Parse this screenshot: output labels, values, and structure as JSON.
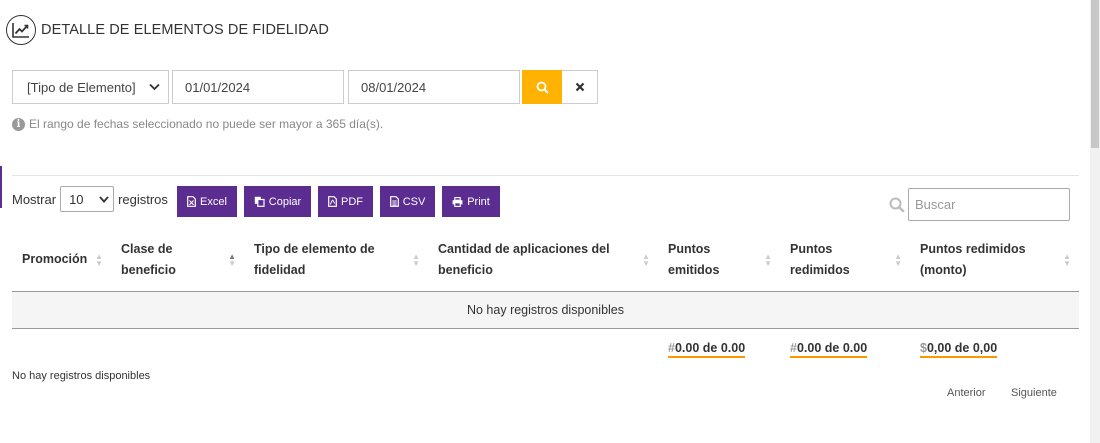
{
  "header": {
    "title": "DETALLE DE ELEMENTOS DE FIDELIDAD",
    "icon": "trend-chart-icon"
  },
  "filters": {
    "element_type": "[Tipo de Elemento]",
    "date_from": "01/01/2024",
    "date_to": "08/01/2024",
    "search_button_icon": "search-icon",
    "clear_button_icon": "close-icon"
  },
  "notice": "El rango de fechas seleccionado no puede ser mayor a 365 día(s).",
  "length": {
    "prefix": "Mostrar",
    "value": "10",
    "suffix": "registros"
  },
  "buttons": {
    "excel": "Excel",
    "copy": "Copiar",
    "pdf": "PDF",
    "csv": "CSV",
    "print": "Print"
  },
  "search": {
    "placeholder": "Buscar"
  },
  "table": {
    "columns": [
      "Promoción",
      "Clase de beneficio",
      "Tipo de elemento de fidelidad",
      "Cantidad de aplicaciones del beneficio",
      "Puntos emitidos",
      "Puntos redimidos",
      "Puntos redimidos (monto)"
    ],
    "empty": "No hay registros disponibles"
  },
  "totals": {
    "emitidos_symbol": "#",
    "emitidos": "0.00 de 0.00",
    "redimidos_symbol": "#",
    "redimidos": "0.00 de 0.00",
    "monto_symbol": "$",
    "monto": "0,00 de 0,00"
  },
  "info": "No hay registros disponibles",
  "pagination": {
    "previous": "Anterior",
    "next": "Siguiente"
  },
  "colors": {
    "accent": "#5c2d91",
    "search": "#ffb300",
    "total_underline": "#ff9800"
  }
}
